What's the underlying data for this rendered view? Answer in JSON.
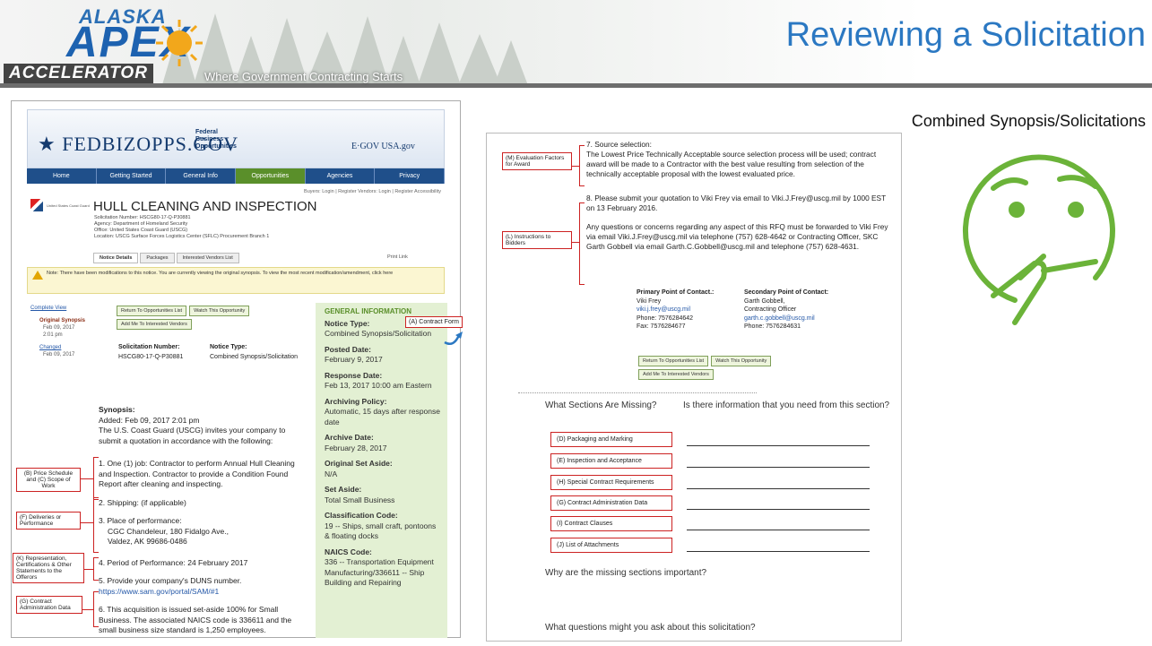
{
  "header": {
    "logo_top": "ALASKA",
    "logo_main": "APEX",
    "logo_bottom": "ACCELERATOR",
    "tagline": "Where Government Contracting Starts",
    "title": "Reviewing a Solicitation",
    "subtitle": "Combined Synopsis/Solicitations"
  },
  "fbo": {
    "logo": "★ FEDBIZOPPS.GOV",
    "federal": [
      "Federal",
      "Business",
      "Opportunities"
    ],
    "egov": "E·GOV  USA.gov",
    "nav": [
      "Home",
      "Getting Started",
      "General Info",
      "Opportunities",
      "Agencies",
      "Privacy"
    ],
    "buyers": "Buyers: Login | Register   Vendors: Login | Register   Accessibility",
    "agency_logo": "United States Coast Guard",
    "title": "HULL CLEANING AND INSPECTION",
    "meta": [
      "Solicitation Number: HSCG80-17-Q-P30881",
      "Agency: Department of Homeland Security",
      "Office: United States Coast Guard (USCG)",
      "Location: USCG Surface Forces Logistics Center (SFLC) Procurement Branch 1"
    ],
    "tabs": [
      "Notice Details",
      "Packages",
      "Interested Vendors List"
    ],
    "print": "Print   Link",
    "note": "Note: There have been modifications to this notice. You are currently viewing the original synopsis. To view the most recent modification/amendment, click here",
    "side": {
      "complete": "Complete View",
      "original": "Original Synopsis",
      "orig_date": "Feb 09, 2017",
      "orig_time": "2:01 pm",
      "changed": "Changed",
      "changed_date": "Feb 09, 2017"
    },
    "buttons": [
      "Return To Opportunities List",
      "Watch This Opportunity",
      "Add Me To Interested Vendors"
    ],
    "sol_num_label": "Solicitation Number:",
    "sol_num": "HSCG80-17-Q-P30881",
    "notice_type_label": "Notice Type:",
    "notice_type": "Combined Synopsis/Solicitation",
    "synopsis_head": "Synopsis:",
    "synopsis_added": "Added: Feb 09, 2017 2:01 pm",
    "synopsis_intro": "The U.S. Coast Guard (USCG) invites your company to submit a quotation in accordance with the following:",
    "items": [
      "1. One (1) job: Contractor to perform Annual Hull Cleaning and Inspection. Contractor to provide a Condition Found Report after cleaning and inspecting.",
      "2. Shipping: (if applicable)",
      "3. Place of performance:",
      "CGC Chandeleur, 180 Fidalgo Ave.,",
      "Valdez, AK 99686-0486",
      "4. Period of Performance: 24 February 2017",
      "5. Provide your company's DUNS number.",
      "https://www.sam.gov/portal/SAM/#1",
      "6. This acquisition is issued set-aside 100% for Small Business. The associated NAICS code is 336611 and the small business size standard is 1,250 employees."
    ],
    "general": {
      "title": "GENERAL INFORMATION",
      "notice_type_h": "Notice Type:",
      "notice_type": "Combined Synopsis/Solicitation",
      "posted_h": "Posted Date:",
      "posted": "February 9, 2017",
      "response_h": "Response Date:",
      "response": "Feb 13, 2017 10:00 am Eastern",
      "archiving_h": "Archiving Policy:",
      "archiving": "Automatic, 15 days after response date",
      "archive_h": "Archive Date:",
      "archive": "February 28, 2017",
      "orig_setaside_h": "Original Set Aside:",
      "orig_setaside": "N/A",
      "setaside_h": "Set Aside:",
      "setaside": "Total Small Business",
      "class_h": "Classification Code:",
      "class": "19 -- Ships, small craft, pontoons & floating docks",
      "naics_h": "NAICS Code:",
      "naics": "336 -- Transportation Equipment Manufacturing/336611 -- Ship Building and Repairing"
    }
  },
  "labels": {
    "contract_form": "(A) Contract Form",
    "price_schedule": "(B) Price Schedule and (C) Scope of Work",
    "deliveries": "(F) Deliveries or Performance",
    "representation": "(K) Representation, Certifications & Other Statements to the Offerors",
    "contract_admin": "(G) Contract Administration Data",
    "evaluation": "(M) Evaluation Factors for Award",
    "instructions": "(L) Instructions to Bidders"
  },
  "doc": {
    "p7_head": "7. Source selection:",
    "p7": "The Lowest Price Technically Acceptable source selection process will be used; contract award will be made to a Contractor with the best value resulting from selection of the technically acceptable proposal with the lowest evaluated price.",
    "p8": "8. Please submit your quotation to Viki Frey via email to Viki.J.Frey@uscg.mil by 1000 EST on 13 February 2016.",
    "p9": "Any questions or concerns regarding any aspect of this RFQ must be forwarded to Viki Frey via email Viki.J.Frey@uscg.mil via telephone (757) 628-4642 or Contracting Officer, SKC Garth Gobbell via email Garth.C.Gobbell@uscg.mil and telephone (757) 628-4631.",
    "primary_h": "Primary Point of Contact.:",
    "primary": [
      "Viki Frey",
      "viki.j.frey@uscg.mil",
      "Phone: 7576284642",
      "Fax: 7576284677"
    ],
    "secondary_h": "Secondary Point of Contact:",
    "secondary": [
      "Garth Gobbell,",
      "Contracting Officer",
      "garth.c.gobbell@uscg.mil",
      "Phone: 7576284631"
    ]
  },
  "questions": {
    "missing": "What Sections Are Missing?",
    "need": "Is there information that you need from this section?",
    "sections": [
      "(D) Packaging and Marking",
      "(E) Inspection and Acceptance",
      "(H) Special Contract Requirements",
      "(G) Contract Administration Data",
      "(I) Contract Clauses",
      "(J) List of Attachments"
    ],
    "why": "Why are the missing sections important?",
    "what": "What questions might you ask about this solicitation?"
  },
  "colors": {
    "title_blue": "#2b78c2",
    "label_red": "#cc2222",
    "face_green": "#6bb339"
  }
}
